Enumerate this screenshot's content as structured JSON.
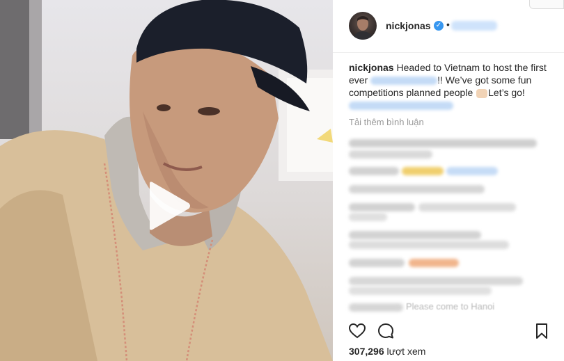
{
  "post": {
    "username": "nickjonas",
    "caption_prefix": "Headed to Vietnam to host the first ever",
    "caption_middle": "!! We’ve got some fun competitions planned people",
    "caption_suffix": "Let’s go!",
    "load_more_comments": "Tải thêm bình luận",
    "last_comment_text": "Please come to Hanoi",
    "view_count": "307,296",
    "views_label": "lượt xem"
  },
  "icons": {
    "verified": "verified-badge-icon",
    "play": "play-icon",
    "like": "heart-icon",
    "comment": "comment-bubble-icon",
    "save": "bookmark-icon"
  },
  "colors": {
    "verified": "#3897f0",
    "text": "#262626",
    "muted": "#999999"
  }
}
